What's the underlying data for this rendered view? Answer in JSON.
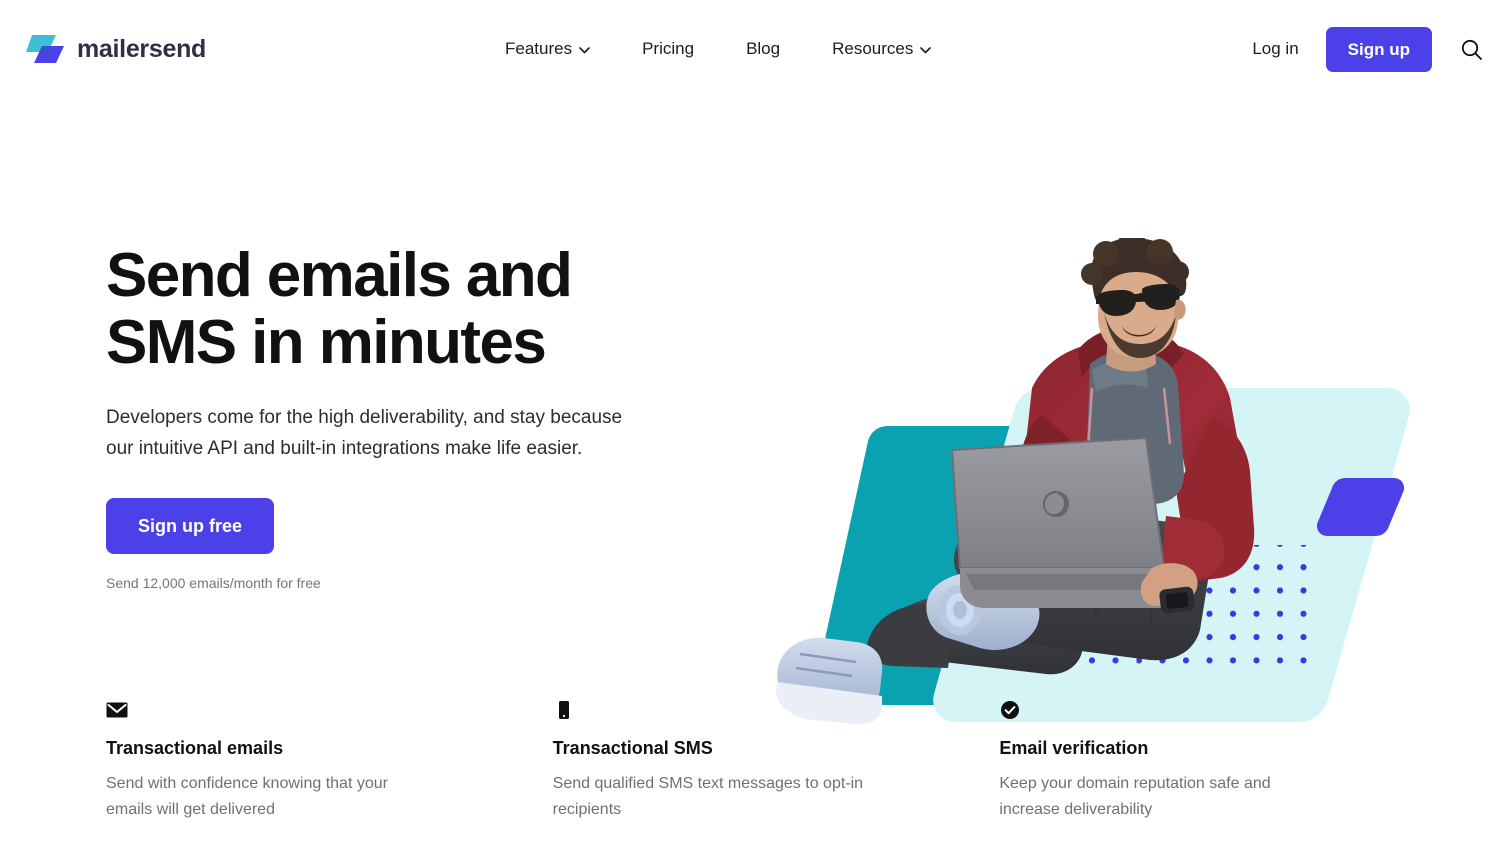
{
  "brand": {
    "name": "mailersend",
    "logo_icon": "mailersend-bolt-logo",
    "logo_colors": {
      "teal": "#3dbfd4",
      "blue": "#4c41e8"
    }
  },
  "header": {
    "nav": [
      {
        "label": "Features",
        "has_dropdown": true,
        "icon": "chevron-down-icon"
      },
      {
        "label": "Pricing",
        "has_dropdown": false
      },
      {
        "label": "Blog",
        "has_dropdown": false
      },
      {
        "label": "Resources",
        "has_dropdown": true,
        "icon": "chevron-down-icon"
      }
    ],
    "login_label": "Log in",
    "signup_label": "Sign up",
    "search_icon": "search-icon",
    "accent_color": "#4c41e8"
  },
  "hero": {
    "title": "Send emails and\nSMS in minutes",
    "subtitle": "Developers come for the high deliverability, and stay because\nour intuitive API and built-in integrations make life easier.",
    "cta_label": "Sign up free",
    "cta_note": "Send 12,000 emails/month for free",
    "artwork": {
      "description": "Man with sunglasses sitting cross-legged using a laptop",
      "shape_teal": "#0aa2b0",
      "shape_cyan": "#d5f4f5",
      "shape_purple": "#4c41e8",
      "dot_color": "#3b38e0"
    }
  },
  "features": [
    {
      "icon": "envelope-icon",
      "title": "Transactional emails",
      "description": "Send with confidence knowing that your emails will get delivered"
    },
    {
      "icon": "mobile-phone-icon",
      "title": "Transactional SMS",
      "description": "Send qualified SMS text messages to opt-in recipients"
    },
    {
      "icon": "check-circle-icon",
      "title": "Email verification",
      "description": "Keep your domain reputation safe and increase deliverability"
    }
  ]
}
